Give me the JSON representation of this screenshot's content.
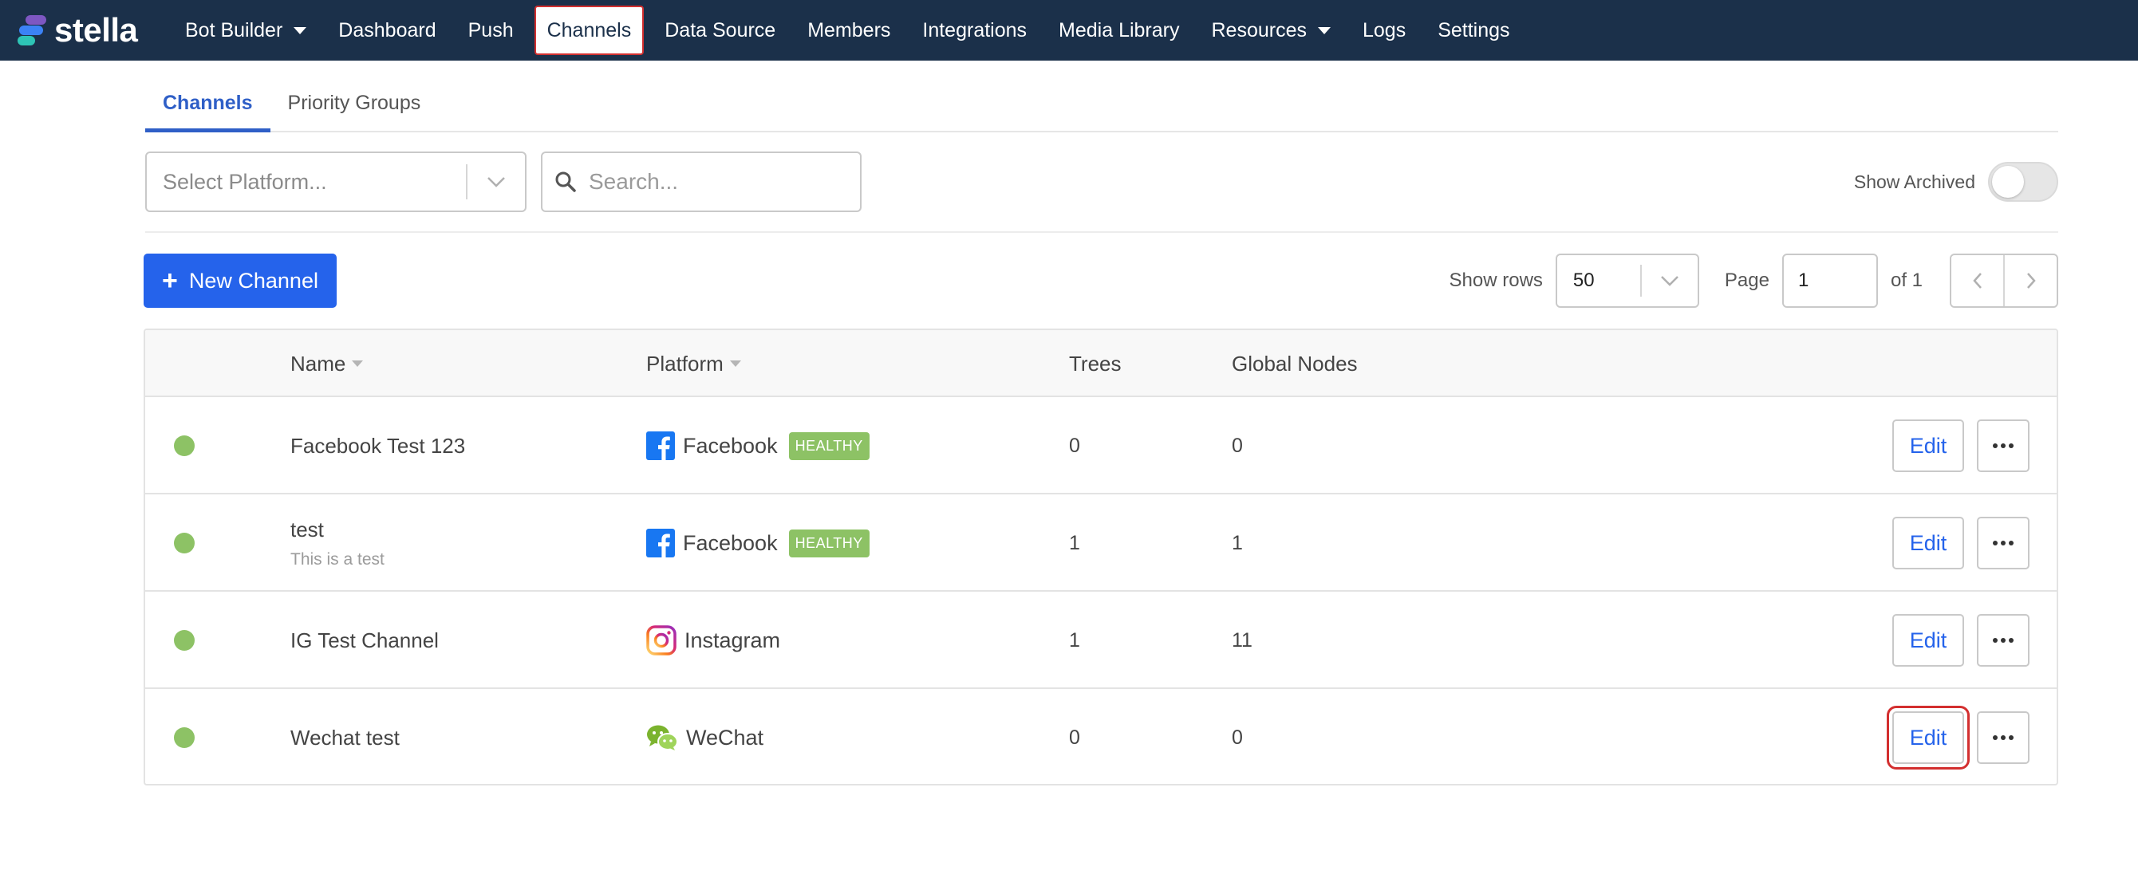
{
  "app": {
    "brand": "stella"
  },
  "nav": {
    "items": [
      {
        "label": "Bot Builder",
        "dropdown": true
      },
      {
        "label": "Dashboard"
      },
      {
        "label": "Push"
      },
      {
        "label": "Channels",
        "active": true
      },
      {
        "label": "Data Source"
      },
      {
        "label": "Members"
      },
      {
        "label": "Integrations"
      },
      {
        "label": "Media Library"
      },
      {
        "label": "Resources",
        "dropdown": true
      },
      {
        "label": "Logs"
      },
      {
        "label": "Settings"
      }
    ]
  },
  "tabs": [
    {
      "label": "Channels",
      "active": true
    },
    {
      "label": "Priority Groups"
    }
  ],
  "filters": {
    "platform_placeholder": "Select Platform...",
    "search_placeholder": "Search...",
    "show_archived_label": "Show Archived",
    "show_archived_on": false
  },
  "toolbar": {
    "new_channel_label": "New Channel",
    "show_rows_label": "Show rows",
    "rows_value": "50",
    "page_label": "Page",
    "page_value": "1",
    "page_of": "of 1"
  },
  "table": {
    "columns": [
      "Name",
      "Platform",
      "Trees",
      "Global Nodes"
    ],
    "rows": [
      {
        "name": "Facebook Test 123",
        "description": "",
        "platform": "Facebook",
        "platform_icon": "facebook-icon",
        "badge": "HEALTHY",
        "trees": "0",
        "global_nodes": "0",
        "edit_label": "Edit"
      },
      {
        "name": "test",
        "description": "This is a test",
        "platform": "Facebook",
        "platform_icon": "facebook-icon",
        "badge": "HEALTHY",
        "trees": "1",
        "global_nodes": "1",
        "edit_label": "Edit"
      },
      {
        "name": "IG Test Channel",
        "description": "",
        "platform": "Instagram",
        "platform_icon": "instagram-icon",
        "badge": "",
        "trees": "1",
        "global_nodes": "11",
        "edit_label": "Edit"
      },
      {
        "name": "Wechat test",
        "description": "",
        "platform": "WeChat",
        "platform_icon": "wechat-icon",
        "badge": "",
        "trees": "0",
        "global_nodes": "0",
        "edit_label": "Edit"
      }
    ]
  },
  "colors": {
    "navbar": "#1b304a",
    "primary": "#2563eb",
    "healthy": "#8dc265",
    "highlight": "#d32f2f"
  }
}
